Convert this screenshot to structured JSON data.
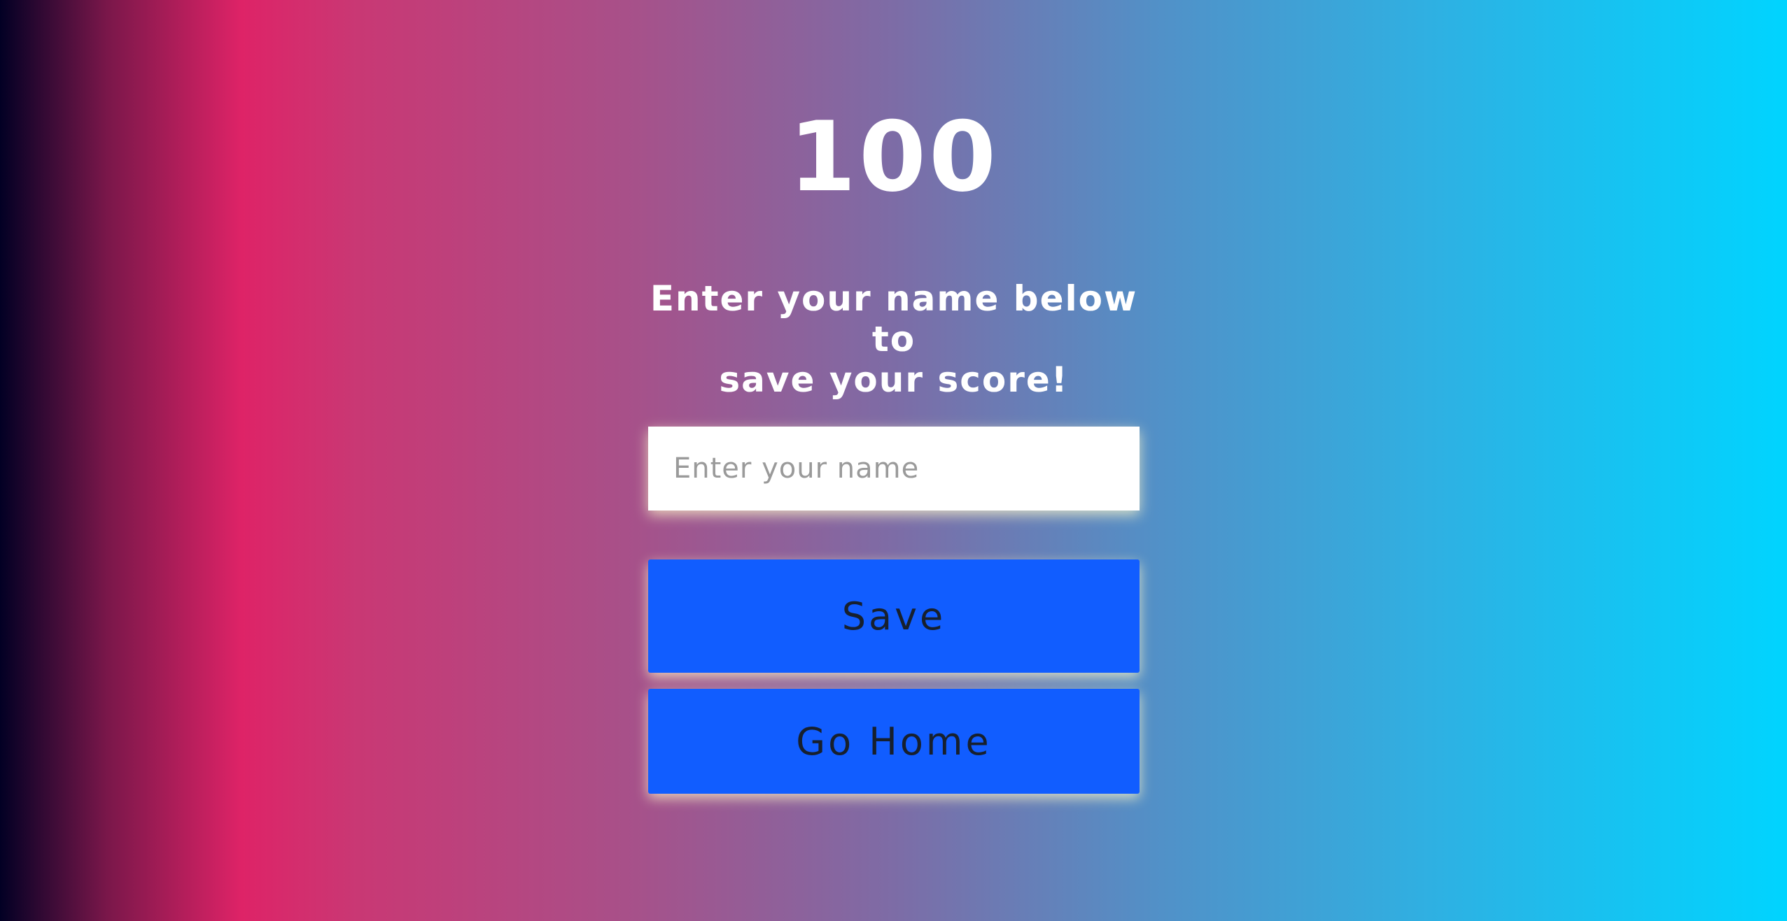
{
  "score": "100",
  "prompt": {
    "line1": "Enter your name below to",
    "line2": "save your score!"
  },
  "name_input": {
    "value": "",
    "placeholder": "Enter your name"
  },
  "buttons": {
    "save_label": "Save",
    "home_label": "Go Home"
  },
  "colors": {
    "button_bg": "#115dff",
    "gradient_start": "#020024",
    "gradient_pink": "#de2367",
    "gradient_end": "#00d4ff"
  }
}
